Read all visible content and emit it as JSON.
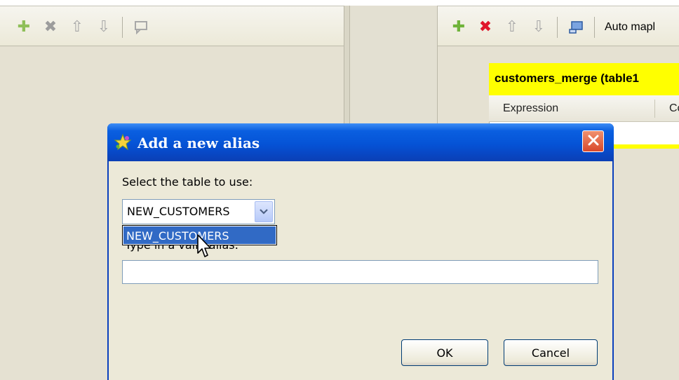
{
  "left_toolbar": {
    "icons": [
      "plus-icon",
      "delete-icon",
      "move-up-icon",
      "move-down-icon",
      "comment-icon"
    ]
  },
  "right_toolbar": {
    "icons": [
      "plus-icon",
      "delete-icon",
      "move-up-icon",
      "move-down-icon",
      "layout-icon"
    ],
    "auto_map_label": "Auto mapl"
  },
  "output_table": {
    "title": "customers_merge (table1",
    "columns": [
      "Expression",
      "Co"
    ],
    "accent_color": "#ffff00"
  },
  "dialog": {
    "title": "Add a new alias",
    "select_label": "Select the table to use:",
    "selected_table": "NEW_CUSTOMERS",
    "dropdown_options": [
      "NEW_CUSTOMERS"
    ],
    "alias_label": "Type in a valid alias:",
    "alias_value": "",
    "ok_label": "OK",
    "cancel_label": "Cancel",
    "title_bar_color": "#0553d6",
    "selection_color": "#316ac5"
  }
}
